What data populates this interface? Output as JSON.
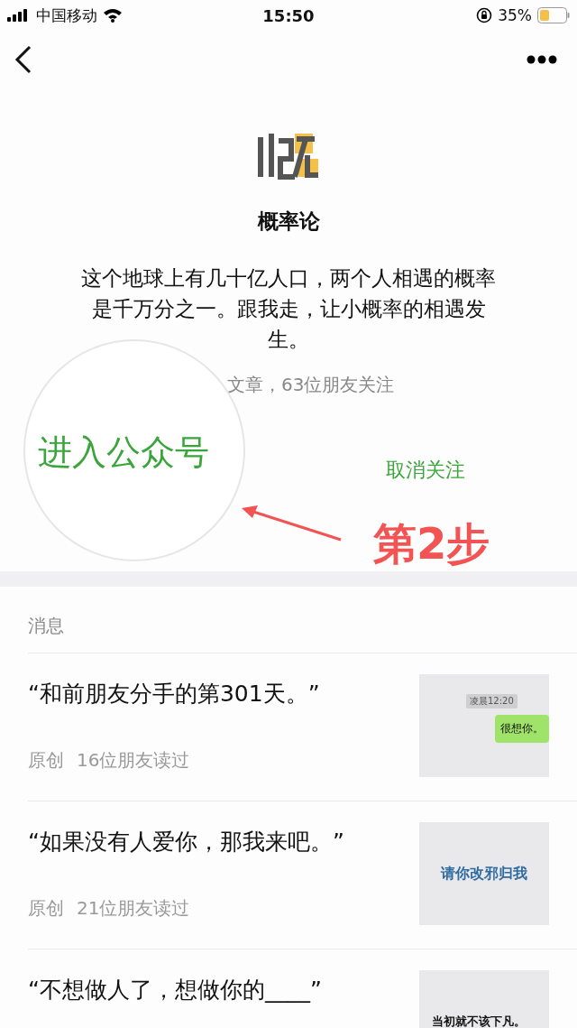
{
  "status_bar": {
    "carrier": "中国移动",
    "time": "15:50",
    "battery": "35%"
  },
  "profile": {
    "name": "概率论",
    "description": "这个地球上有几十亿人口，两个人相遇的概率是千万分之一。跟我走，让小概率的相遇发生。",
    "stats": "文章，63位朋友关注",
    "enter_button": "进入公众号",
    "unfollow": "取消关注",
    "step_label": "第2步"
  },
  "messages": {
    "header": "消息",
    "items": [
      {
        "title": "“和前朋友分手的第301天。”",
        "tag": "原创",
        "reads": "16位朋友读过",
        "thumbnail": {
          "kind": "chat",
          "time": "凌晨12:20",
          "bubble": "很想你。"
        }
      },
      {
        "title": "“如果没有人爱你，那我来吧。”",
        "tag": "原创",
        "reads": "21位朋友读过",
        "thumbnail": {
          "kind": "caption",
          "text": "请你改邪归我",
          "color": "#2f6aa0"
        }
      },
      {
        "title": "“不想做人了，想做你的____”",
        "thumbnail": {
          "kind": "bottom_caption",
          "text": "当初就不该下凡。"
        }
      }
    ]
  }
}
